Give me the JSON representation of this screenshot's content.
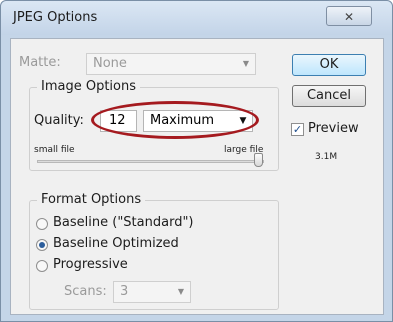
{
  "window": {
    "title": "JPEG Options",
    "close_glyph": "✕"
  },
  "matte": {
    "label": "Matte:",
    "value": "None"
  },
  "image_options": {
    "title": "Image Options",
    "quality_label": "Quality:",
    "quality_value": "12",
    "quality_preset": "Maximum",
    "small_file_label": "small file",
    "large_file_label": "large file",
    "quality_fraction": 1.0
  },
  "format_options": {
    "title": "Format Options",
    "options": [
      "Baseline (\"Standard\")",
      "Baseline Optimized",
      "Progressive"
    ],
    "selected": "Baseline Optimized",
    "scans_label": "Scans:",
    "scans_value": "3"
  },
  "buttons": {
    "ok": "OK",
    "cancel": "Cancel"
  },
  "preview": {
    "label": "Preview",
    "checked": true,
    "check_glyph": "✓",
    "file_size": "3.1M"
  },
  "annotation_color": "#a51a1f"
}
